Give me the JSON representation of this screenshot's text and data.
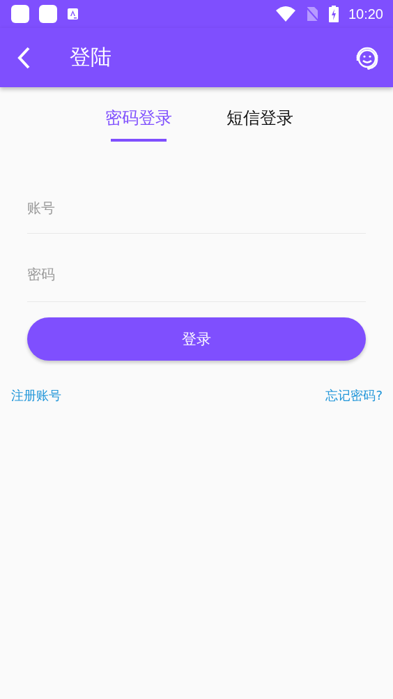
{
  "status_bar": {
    "time": "10:20"
  },
  "header": {
    "title": "登陆"
  },
  "tabs": [
    {
      "label": "密码登录",
      "selected": true
    },
    {
      "label": "短信登录",
      "selected": false
    }
  ],
  "fields": [
    {
      "placeholder": "账号"
    },
    {
      "placeholder": "密码"
    }
  ],
  "login_button": "登录",
  "links": [
    {
      "label": "注册账号"
    },
    {
      "label": "忘记密码?"
    }
  ]
}
